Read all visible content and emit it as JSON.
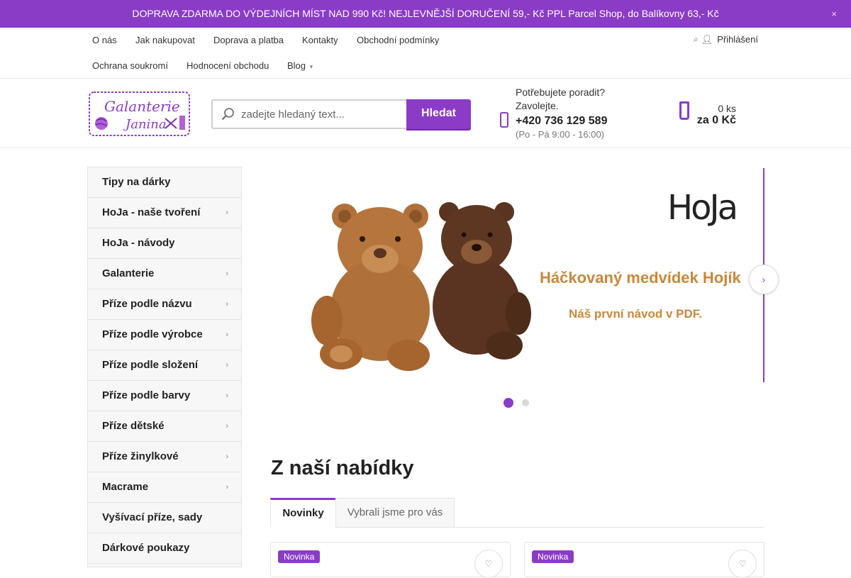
{
  "topbar": {
    "message": "DOPRAVA ZDARMA DO VÝDEJNÍCH MÍST NAD 990 Kč! NEJLEVNĚJŠÍ DORUČENÍ 59,- Kč PPL Parcel Shop, do Balíkovny 63,- Kč",
    "close_icon": "×"
  },
  "nav": {
    "row1": [
      "O nás",
      "Jak nakupovat",
      "Doprava a platba",
      "Kontakty",
      "Obchodní podmínky"
    ],
    "row2": [
      "Ochrana soukromí",
      "Hodnocení obchodu",
      "Blog"
    ],
    "login_label": "Přihlášení"
  },
  "header": {
    "search_placeholder": "zadejte hledaný text...",
    "search_button": "Hledat",
    "contact_line1": "Potřebujete poradit?",
    "contact_line2": "Zavolejte.",
    "phone": "+420 736 129 589",
    "hours": "(Po - Pá 9:00 - 16:00)",
    "cart_count": "0 ks",
    "cart_sum": "za 0 Kč"
  },
  "sidebar": {
    "items": [
      {
        "label": "Tipy na dárky",
        "has_children": false
      },
      {
        "label": "HoJa - naše tvoření",
        "has_children": true
      },
      {
        "label": "HoJa - návody",
        "has_children": false
      },
      {
        "label": "Galanterie",
        "has_children": true
      },
      {
        "label": "Příze podle názvu",
        "has_children": true
      },
      {
        "label": "Příze podle výrobce",
        "has_children": true
      },
      {
        "label": "Příze podle složení",
        "has_children": true
      },
      {
        "label": "Příze podle barvy",
        "has_children": true
      },
      {
        "label": "Příze dětské",
        "has_children": true
      },
      {
        "label": "Příze žinylkové",
        "has_children": true
      },
      {
        "label": "Macrame",
        "has_children": true
      },
      {
        "label": "Vyšívací příze, sady",
        "has_children": false
      },
      {
        "label": "Dárkové poukazy",
        "has_children": false
      }
    ]
  },
  "banner": {
    "brand": "HoJa",
    "headline": "Háčkovaný medvídek Hojík",
    "subline": "Náš první návod v PDF.",
    "slides_total": 2,
    "active_slide": 1
  },
  "section": {
    "title": "Z naší nabídky",
    "tabs": [
      "Novinky",
      "Vybrali jsme pro vás"
    ]
  },
  "products": [
    {
      "badge": "Novinka"
    },
    {
      "badge": "Novinka"
    }
  ],
  "colors": {
    "accent": "#8a3cc7",
    "bear_light": "#b0703a",
    "bear_dark": "#5a3420",
    "banner_text": "#c9883a"
  }
}
